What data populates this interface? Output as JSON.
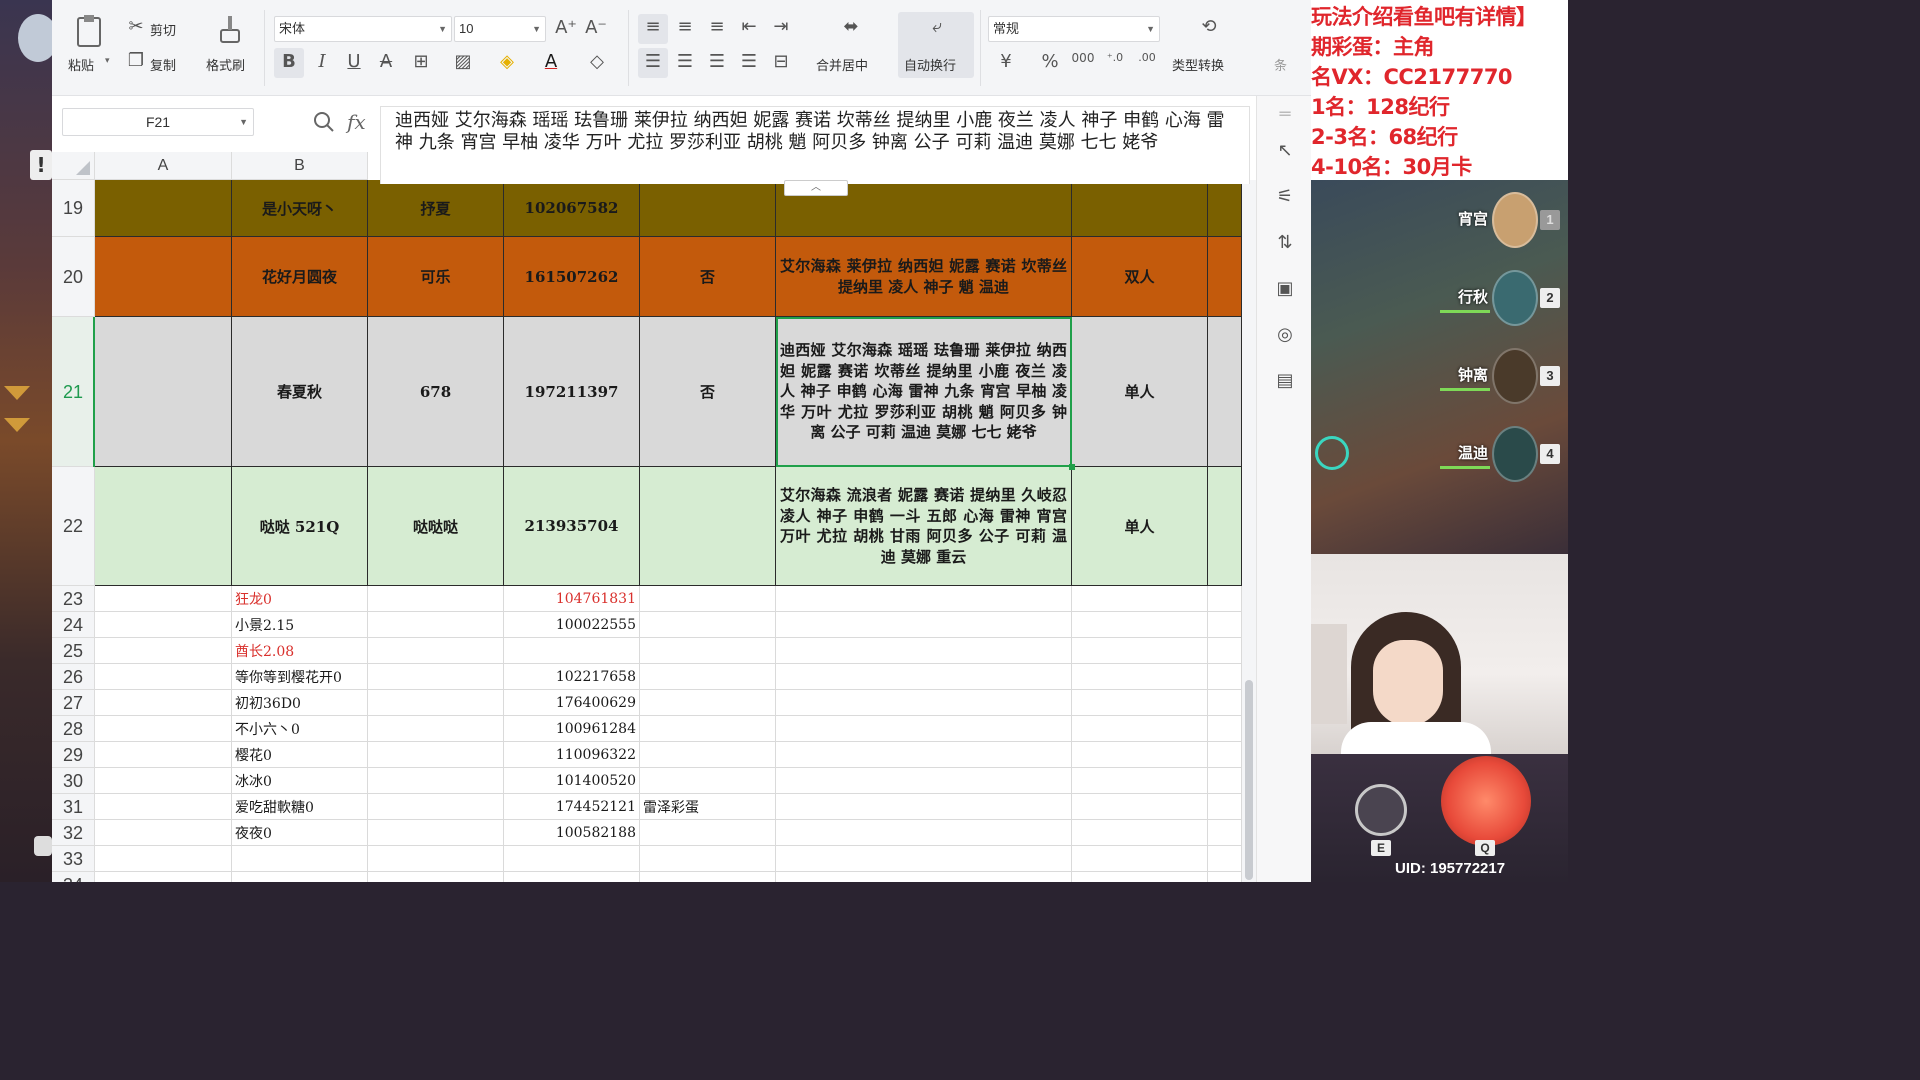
{
  "ribbon": {
    "paste": "粘贴",
    "cut": "剪切",
    "copy": "复制",
    "format_painter": "格式刷",
    "font_name": "宋体",
    "font_size": "10",
    "merge_center": "合并居中",
    "wrap_text": "自动换行",
    "number_format": "常规",
    "type_convert": "类型转换",
    "more": "条"
  },
  "formula_bar": {
    "cell_ref": "F21",
    "fx": "fx",
    "content": "迪西娅 艾尔海森 瑶瑶 珐鲁珊 莱伊拉 纳西妲 妮露 赛诺 坎蒂丝 提纳里 小鹿 夜兰 凌人 神子 申鹤 心海 雷神 九条 宵宫 早柚 凌华 万叶 尤拉 罗莎利亚 胡桃 魈 阿贝多 钟离 公子 可莉 温迪 莫娜 七七 姥爷"
  },
  "columns": [
    "A",
    "B"
  ],
  "rows": [
    {
      "num": "19",
      "b": "是小天呀丶",
      "c": "抒夏",
      "d": "102067582",
      "e": "",
      "f": "",
      "g": ""
    },
    {
      "num": "20",
      "b": "花好月圆夜",
      "c": "可乐",
      "d": "161507262",
      "e": "否",
      "f": "艾尔海森 莱伊拉 纳西妲 妮露 赛诺 坎蒂丝 提纳里 凌人 神子 魈 温迪",
      "g": "双人"
    },
    {
      "num": "21",
      "b": "春夏秋",
      "c": "678",
      "d": "197211397",
      "e": "否",
      "f": "迪西娅 艾尔海森 瑶瑶 珐鲁珊 莱伊拉 纳西妲 妮露 赛诺 坎蒂丝 提纳里 小鹿 夜兰 凌人 神子 申鹤 心海 雷神 九条 宵宫 早柚 凌华 万叶 尤拉 罗莎利亚 胡桃 魈 阿贝多 钟离 公子 可莉 温迪 莫娜 七七 姥爷",
      "g": "单人"
    },
    {
      "num": "22",
      "b": "哒哒 521Q",
      "c": "哒哒哒",
      "d": "213935704",
      "e": "",
      "f": "艾尔海森 流浪者 妮露 赛诺 提纳里 久岐忍 凌人 神子 申鹤 一斗 五郎 心海 雷神 宵宫 万叶 尤拉 胡桃 甘雨 阿贝多 公子 可莉 温迪 莫娜 重云",
      "g": "单人"
    },
    {
      "num": "23",
      "b": "狂龙0",
      "d": "104761831",
      "e": "",
      "red": true
    },
    {
      "num": "24",
      "b": "小景2.15",
      "d": "100022555",
      "e": ""
    },
    {
      "num": "25",
      "b": "酋长2.08",
      "d": "",
      "e": "",
      "red": true
    },
    {
      "num": "26",
      "b": "等你等到樱花开0",
      "d": "102217658",
      "e": ""
    },
    {
      "num": "27",
      "b": "初初36D0",
      "d": "176400629",
      "e": ""
    },
    {
      "num": "28",
      "b": "不小六丶0",
      "d": "100961284",
      "e": ""
    },
    {
      "num": "29",
      "b": "樱花0",
      "d": "110096322",
      "e": ""
    },
    {
      "num": "30",
      "b": "冰冰0",
      "d": "101400520",
      "e": ""
    },
    {
      "num": "31",
      "b": "爱吃甜軟糖0",
      "d": "174452121",
      "e": "雷泽彩蛋"
    },
    {
      "num": "32",
      "b": "夜夜0",
      "d": "100582188",
      "e": ""
    },
    {
      "num": "33",
      "b": "",
      "d": "",
      "e": ""
    },
    {
      "num": "34",
      "b": "",
      "d": "",
      "e": ""
    }
  ],
  "stream": {
    "promo": [
      "玩法介绍看鱼吧有详情】",
      "期彩蛋：主角",
      "名VX：CC2177770",
      "1名：128纪行",
      "2-3名：68纪行",
      "4-10名：30月卡"
    ],
    "team": [
      {
        "name": "宵宫",
        "index": "1"
      },
      {
        "name": "行秋",
        "index": "2"
      },
      {
        "name": "钟离",
        "index": "3"
      },
      {
        "name": "温迪",
        "index": "4"
      }
    ],
    "key_e": "E",
    "key_q": "Q",
    "uid": "UID: 195772217"
  },
  "colors": {
    "row19": "#7a6000",
    "row20": "#c35a0c",
    "row21": "#d9d9d9",
    "row22": "#d6ecd2",
    "selection": "#20a04a"
  }
}
